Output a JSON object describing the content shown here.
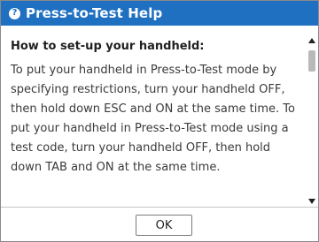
{
  "window": {
    "title": "Press-to-Test Help",
    "icon": "question-mark-icon",
    "icon_glyph": "?",
    "accent_color": "#1f70c1"
  },
  "content": {
    "heading": "How to set-up your handheld:",
    "paragraph": "To put your handheld in Press-to-Test mode by specifying restrictions, turn your handheld OFF, then hold down ESC and ON at the same time. To put your handheld in Press-to-Test mode using a test code, turn your handheld OFF, then hold down TAB and ON at the same time."
  },
  "scrollbar": {
    "up_icon": "scroll-up-arrow-icon",
    "down_icon": "scroll-down-arrow-icon"
  },
  "buttons": {
    "ok_label": "OK"
  }
}
